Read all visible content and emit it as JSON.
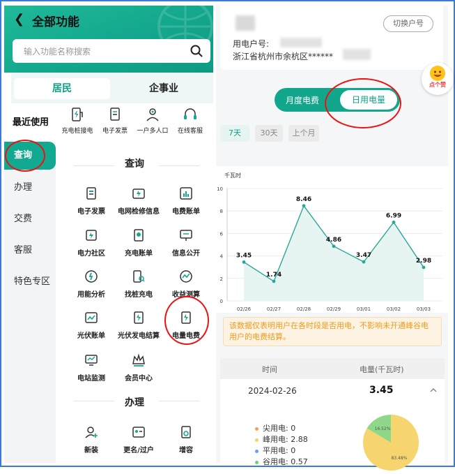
{
  "header": {
    "title": "全部功能",
    "search_placeholder": "输入功能名称搜索"
  },
  "tabs": [
    {
      "label": "居民"
    },
    {
      "label": "企事业"
    }
  ],
  "recent": {
    "label": "最近使用",
    "items": [
      {
        "label": "充电桩接电",
        "icon": "charger-icon"
      },
      {
        "label": "电子发票",
        "icon": "invoice-icon"
      },
      {
        "label": "一户多人口",
        "icon": "users-icon"
      },
      {
        "label": "在线客服",
        "icon": "headset-icon"
      }
    ]
  },
  "sidenav": [
    {
      "label": "查询"
    },
    {
      "label": "办理"
    },
    {
      "label": "交费"
    },
    {
      "label": "客服"
    },
    {
      "label": "特色专区"
    }
  ],
  "sections": {
    "query": {
      "title": "查询",
      "items": [
        {
          "label": "电子发票",
          "icon": "invoice-icon"
        },
        {
          "label": "电网检修信息",
          "icon": "grid-maintenance-icon"
        },
        {
          "label": "电费账单",
          "icon": "bill-chart-icon"
        },
        {
          "label": "电力社区",
          "icon": "community-icon"
        },
        {
          "label": "充电账单",
          "icon": "charge-bill-icon"
        },
        {
          "label": "信息公开",
          "icon": "info-board-icon"
        },
        {
          "label": "用能分析",
          "icon": "energy-analysis-icon"
        },
        {
          "label": "找桩充电",
          "icon": "find-charger-icon"
        },
        {
          "label": "收益测算",
          "icon": "calculator-icon"
        },
        {
          "label": "光伏账单",
          "icon": "solar-bill-icon"
        },
        {
          "label": "光伏发电结算",
          "icon": "solar-settle-icon"
        },
        {
          "label": "电量电费",
          "icon": "power-fee-icon"
        },
        {
          "label": "电站监测",
          "icon": "monitor-icon"
        },
        {
          "label": "会员中心",
          "icon": "crown-icon"
        }
      ]
    },
    "handle": {
      "title": "办理",
      "items": [
        {
          "label": "新装",
          "icon": "new-install-icon"
        },
        {
          "label": "更名/过户",
          "icon": "transfer-icon"
        },
        {
          "label": "增容",
          "icon": "capacity-icon"
        }
      ]
    }
  },
  "account": {
    "switch_label": "切换户号",
    "line1": "用电户号:",
    "line2": "浙江省杭州市余杭区******",
    "badge_label": "点个赞"
  },
  "toggle": {
    "monthly": "月度电费",
    "daily": "日用电量"
  },
  "ranges": [
    {
      "label": "7天"
    },
    {
      "label": "30天"
    },
    {
      "label": "上个月"
    }
  ],
  "chart_data": {
    "type": "area",
    "ylabel": "千瓦时",
    "ylim": [
      0,
      10
    ],
    "yticks": [
      0,
      2,
      4,
      6,
      8,
      10
    ],
    "categories": [
      "02/26",
      "02/27",
      "02/28",
      "02/29",
      "03/01",
      "03/02",
      "03/03"
    ],
    "values": [
      3.45,
      1.74,
      8.46,
      4.86,
      3.47,
      6.99,
      2.98
    ],
    "labels": [
      "3.45",
      "1.74",
      "8.46",
      "4.86",
      "3.47",
      "6.99",
      "2.98"
    ],
    "color": "#2aa79b",
    "grid": true
  },
  "notice": "该数据仅表明用户在各时段是否用电，不影响未开通峰谷电用户的电费结算。",
  "table": {
    "col_time": "时间",
    "col_value": "电量(千瓦时)",
    "row": {
      "date": "2024-02-26",
      "value": "3.45",
      "breakdown": [
        {
          "label": "尖用电:",
          "value": "0",
          "color": "#f0a35c"
        },
        {
          "label": "峰用电:",
          "value": "2.88",
          "color": "#f5d36b"
        },
        {
          "label": "平用电:",
          "value": "0",
          "color": "#6b9ef0"
        },
        {
          "label": "谷用电:",
          "value": "0.57",
          "color": "#6fd07a"
        }
      ],
      "pie": [
        {
          "label": "16.52%",
          "value": 16.52,
          "color": "#8fd88a"
        },
        {
          "label": "83.48%",
          "value": 83.48,
          "color": "#f6d56e"
        }
      ]
    }
  }
}
